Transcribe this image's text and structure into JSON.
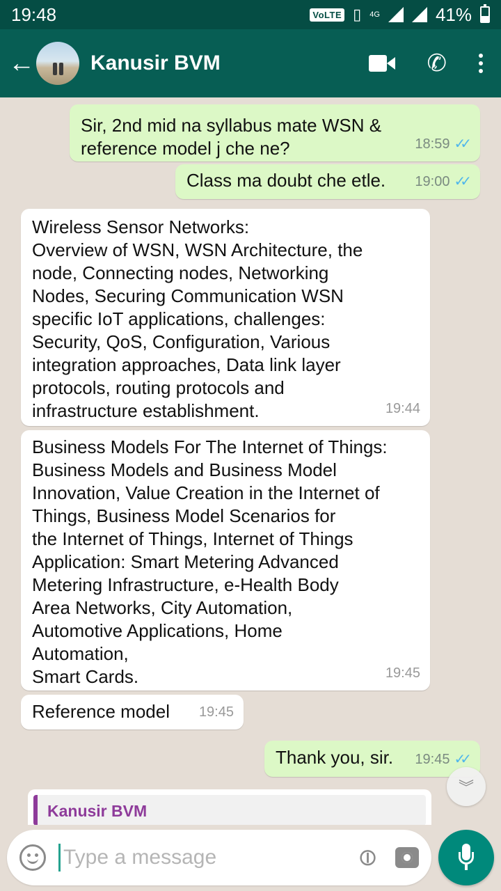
{
  "status_bar": {
    "time": "19:48",
    "volte": "VoLTE",
    "network": "4G",
    "battery": "41%"
  },
  "header": {
    "contact_name": "Kanusir BVM",
    "icons": [
      "back-arrow-icon",
      "video-call-icon",
      "phone-icon",
      "more-options-icon"
    ]
  },
  "messages": [
    {
      "direction": "out",
      "text": "Sir, 2nd mid na syllabus mate WSN &\nreference model j che ne?",
      "time": "18:59",
      "read": true
    },
    {
      "direction": "out",
      "text": "Class ma doubt che etle.",
      "time": "19:00",
      "read": true
    },
    {
      "direction": "in",
      "text": "Wireless Sensor Networks:\nOverview of WSN, WSN Architecture, the\nnode, Connecting nodes, Networking\nNodes, Securing Communication WSN\nspecific IoT applications, challenges:\nSecurity, QoS, Configuration, Various\nintegration approaches, Data link layer\nprotocols, routing protocols and\ninfrastructure establishment.",
      "time": "19:44"
    },
    {
      "direction": "in",
      "text": "Business Models For The Internet of Things:\nBusiness Models and Business Model\nInnovation, Value Creation in the Internet of\nThings, Business Model Scenarios for\nthe Internet of Things, Internet of Things\nApplication: Smart Metering Advanced\nMetering Infrastructure, e-Health Body\nArea Networks, City Automation,\nAutomotive Applications, Home\nAutomation,\nSmart Cards.",
      "time": "19:45"
    },
    {
      "direction": "in",
      "text": "Reference model",
      "time": "19:45"
    },
    {
      "direction": "out",
      "text": "Thank you, sir.",
      "time": "19:45",
      "read": true
    }
  ],
  "quoted_reply": {
    "author": "Kanusir BVM"
  },
  "composer": {
    "placeholder": "Type a message"
  },
  "colors": {
    "header": "#075e54",
    "status_bar": "#054d44",
    "outgoing_bubble": "#dcf8c6",
    "incoming_bubble": "#ffffff",
    "chat_bg": "#e5ddd5",
    "mic_button": "#00897b",
    "read_tick": "#4fb6ec",
    "quote_accent": "#8e3b9a"
  }
}
